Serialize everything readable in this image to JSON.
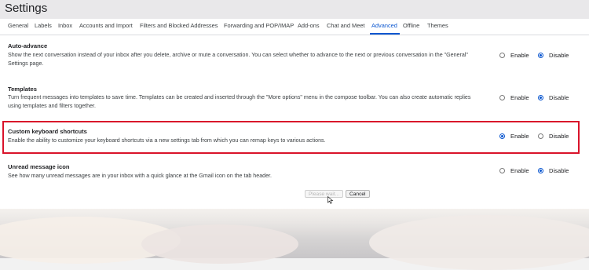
{
  "window": {
    "title": "Settings"
  },
  "tabs": [
    {
      "label": "General"
    },
    {
      "label": "Labels"
    },
    {
      "label": "Inbox"
    },
    {
      "label": "Accounts and Import"
    },
    {
      "label": "Filters and Blocked Addresses"
    },
    {
      "label": "Forwarding and POP/IMAP"
    },
    {
      "label": "Add-ons"
    },
    {
      "label": "Chat and Meet"
    },
    {
      "label": "Advanced"
    },
    {
      "label": "Offline"
    },
    {
      "label": "Themes"
    }
  ],
  "active_tab": "Advanced",
  "settings": [
    {
      "title": "Auto-advance",
      "description": "Show the next conversation instead of your inbox after you delete, archive or mute a conversation. You can select whether to advance to the next or previous conversation in the \"General\" Settings page.",
      "enable_label": "Enable",
      "disable_label": "Disable",
      "selected": "Disable"
    },
    {
      "title": "Templates",
      "description": "Turn frequent messages into templates to save time. Templates can be created and inserted through the \"More options\" menu in the compose toolbar. You can also create automatic replies using templates and filters together.",
      "enable_label": "Enable",
      "disable_label": "Disable",
      "selected": "Disable"
    },
    {
      "title": "Custom keyboard shortcuts",
      "description": "Enable the ability to customize your keyboard shortcuts via a new settings tab from which you can remap keys to various actions.",
      "enable_label": "Enable",
      "disable_label": "Disable",
      "selected": "Enable"
    },
    {
      "title": "Unread message icon",
      "description": "See how many unread messages are in your inbox with a quick glance at the Gmail icon on the tab header.",
      "enable_label": "Enable",
      "disable_label": "Disable",
      "selected": "Disable"
    }
  ],
  "footer": {
    "save_label": "Please wait...",
    "cancel_label": "Cancel"
  },
  "colors": {
    "accent": "#0b57d0",
    "highlight_border": "#d9132a"
  }
}
